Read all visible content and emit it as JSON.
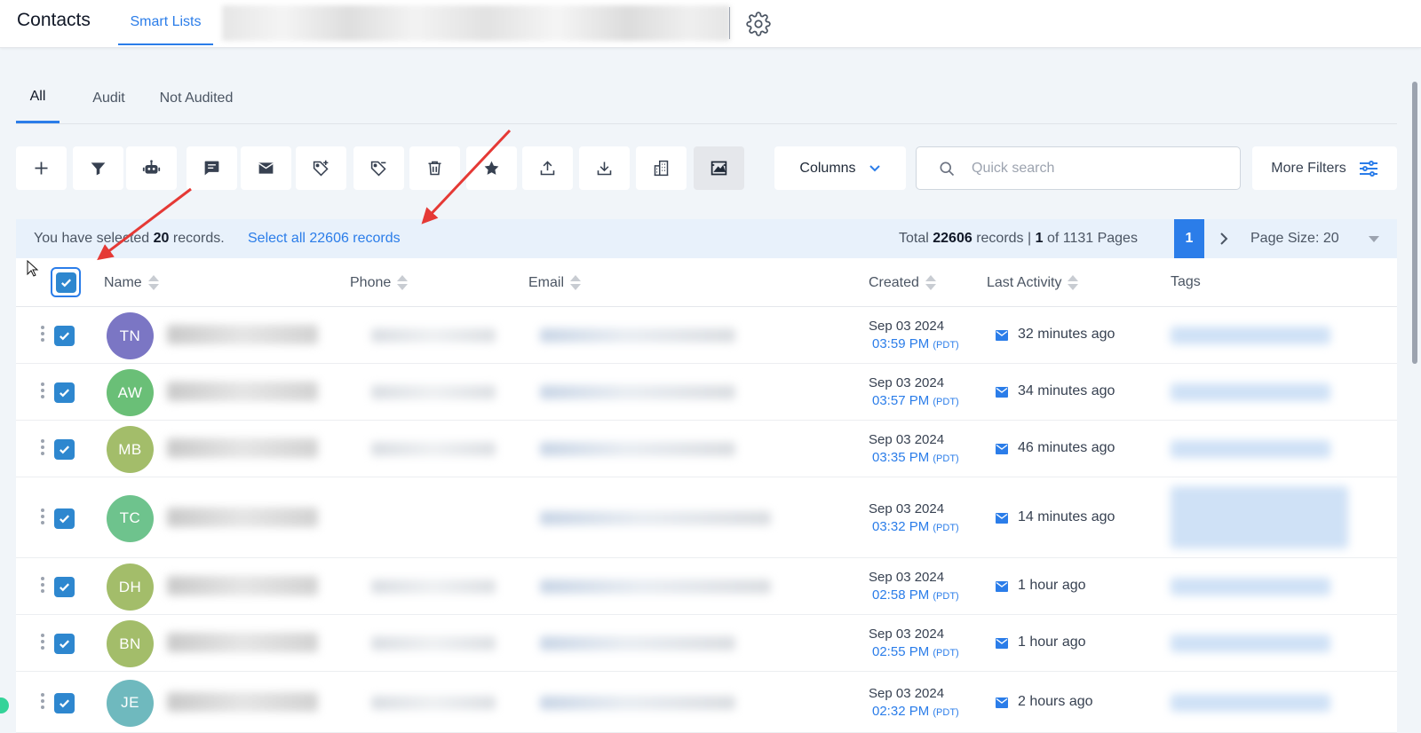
{
  "header": {
    "app_title": "Contacts",
    "active_tab": "Smart Lists",
    "settings_icon": "gear-icon"
  },
  "subtabs": [
    {
      "label": "All",
      "active": true
    },
    {
      "label": "Audit",
      "active": false
    },
    {
      "label": "Not Audited",
      "active": false
    }
  ],
  "toolbar": {
    "tools": [
      {
        "name": "add-contact",
        "icon": "plus-icon"
      },
      {
        "name": "filter",
        "icon": "funnel-icon"
      },
      {
        "name": "automation",
        "icon": "robot-icon"
      },
      {
        "name": "send-sms",
        "icon": "message-icon"
      },
      {
        "name": "send-email",
        "icon": "mail-icon"
      },
      {
        "name": "add-tag",
        "icon": "tag-plus-icon"
      },
      {
        "name": "remove-tag",
        "icon": "tag-minus-icon"
      },
      {
        "name": "delete",
        "icon": "trash-icon"
      },
      {
        "name": "review",
        "icon": "star-icon"
      },
      {
        "name": "export",
        "icon": "upload-icon"
      },
      {
        "name": "import",
        "icon": "download-icon"
      },
      {
        "name": "company",
        "icon": "building-icon"
      },
      {
        "name": "merge",
        "icon": "image-frame-icon"
      }
    ],
    "columns_label": "Columns",
    "search_placeholder": "Quick search",
    "more_filters_label": "More Filters"
  },
  "selection": {
    "prefix": "You have selected ",
    "count": "20",
    "suffix": " records.",
    "select_all": "Select all 22606 records",
    "total_prefix": "Total ",
    "total_count": "22606",
    "total_mid": " records | ",
    "current_page": "1",
    "of_pages": " of 1131 Pages",
    "page_button": "1",
    "page_size": "Page Size: 20"
  },
  "table": {
    "columns": [
      "Name",
      "Phone",
      "Email",
      "Created",
      "Last Activity",
      "Tags"
    ],
    "rows": [
      {
        "initials": "TN",
        "avatar_color": "#7b76c4",
        "date": "Sep 03 2024",
        "time": "03:59 PM",
        "tz": "(PDT)",
        "activity": "32 minutes ago",
        "has_phone": true
      },
      {
        "initials": "AW",
        "avatar_color": "#6abf77",
        "date": "Sep 03 2024",
        "time": "03:57 PM",
        "tz": "(PDT)",
        "activity": "34 minutes ago",
        "has_phone": true
      },
      {
        "initials": "MB",
        "avatar_color": "#a3bd6a",
        "date": "Sep 03 2024",
        "time": "03:35 PM",
        "tz": "(PDT)",
        "activity": "46 minutes ago",
        "has_phone": true
      },
      {
        "initials": "TC",
        "avatar_color": "#6ec38d",
        "date": "Sep 03 2024",
        "time": "03:32 PM",
        "tz": "(PDT)",
        "activity": "14 minutes ago",
        "has_phone": false
      },
      {
        "initials": "DH",
        "avatar_color": "#a3bd6a",
        "date": "Sep 03 2024",
        "time": "02:58 PM",
        "tz": "(PDT)",
        "activity": "1 hour ago",
        "has_phone": true
      },
      {
        "initials": "BN",
        "avatar_color": "#a3bd6a",
        "date": "Sep 03 2024",
        "time": "02:55 PM",
        "tz": "(PDT)",
        "activity": "1 hour ago",
        "has_phone": true
      },
      {
        "initials": "JE",
        "avatar_color": "#6fb9be",
        "date": "Sep 03 2024",
        "time": "02:32 PM",
        "tz": "(PDT)",
        "activity": "2 hours ago",
        "has_phone": true
      }
    ]
  },
  "colors": {
    "accent": "#2b7de9",
    "checkbox": "#2e87cf",
    "annotation_arrow": "#e53935"
  }
}
